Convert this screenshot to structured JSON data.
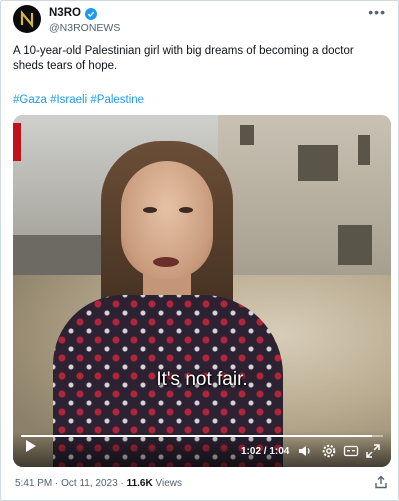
{
  "author": {
    "name": "N3RO",
    "handle": "@N3RONEWS"
  },
  "tweet": {
    "text": "A 10-year-old Palestinian girl with big dreams of becoming a doctor sheds tears of hope.",
    "hashtags": [
      "#Gaza",
      "#Israeli",
      "#Palestine"
    ]
  },
  "video": {
    "caption": "It's not fair.",
    "time": "1:02 / 1:04",
    "progress": 0.97
  },
  "meta": {
    "time": "5:41 PM",
    "date": "Oct 11, 2023",
    "views_count": "11.6K",
    "views_label": "Views"
  },
  "colors": {
    "accent": "#1d9bf0",
    "verified": "#1d9bf0"
  },
  "icons": {
    "more": "more-icon",
    "play": "play-icon",
    "volume": "volume-icon",
    "settings": "settings-icon",
    "closed_captions": "cc-icon",
    "fullscreen": "fullscreen-icon",
    "share": "share-icon"
  }
}
